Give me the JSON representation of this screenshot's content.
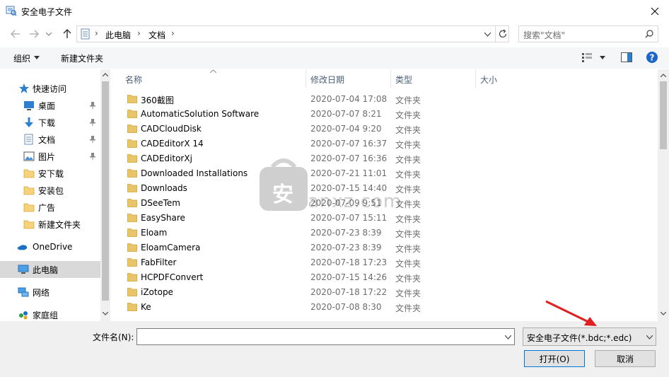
{
  "window": {
    "title": "安全电子文件"
  },
  "address": {
    "breadcrumb": [
      "此电脑",
      "文档"
    ],
    "search_placeholder": "搜索\"文档\""
  },
  "commands": {
    "organize": "组织",
    "new_folder": "新建文件夹"
  },
  "nav": {
    "quick_access": "快速访问",
    "items": [
      {
        "label": "桌面",
        "icon": "desktop-icon",
        "pinned": true
      },
      {
        "label": "下载",
        "icon": "download-icon",
        "pinned": true
      },
      {
        "label": "文档",
        "icon": "document-icon",
        "pinned": true
      },
      {
        "label": "图片",
        "icon": "picture-icon",
        "pinned": true
      },
      {
        "label": "安下载",
        "icon": "folder-icon",
        "pinned": false
      },
      {
        "label": "安装包",
        "icon": "folder-icon",
        "pinned": false
      },
      {
        "label": "广告",
        "icon": "folder-icon",
        "pinned": false
      },
      {
        "label": "新建文件夹",
        "icon": "folder-icon",
        "pinned": false
      }
    ],
    "onedrive": "OneDrive",
    "this_pc": "此电脑",
    "network": "网络",
    "homegroup": "家庭组"
  },
  "columns": {
    "name": "名称",
    "date": "修改日期",
    "type": "类型",
    "size": "大小"
  },
  "files": [
    {
      "name": "360截图",
      "date": "2020-07-04 17:08",
      "type": "文件夹"
    },
    {
      "name": "AutomaticSolution Software",
      "date": "2020-07-07 8:21",
      "type": "文件夹"
    },
    {
      "name": "CADCloudDisk",
      "date": "2020-07-04 9:20",
      "type": "文件夹"
    },
    {
      "name": "CADEditorX 14",
      "date": "2020-07-07 16:37",
      "type": "文件夹"
    },
    {
      "name": "CADEditorXj",
      "date": "2020-07-07 16:36",
      "type": "文件夹"
    },
    {
      "name": "Downloaded Installations",
      "date": "2020-07-21 11:01",
      "type": "文件夹"
    },
    {
      "name": "Downloads",
      "date": "2020-07-15 14:40",
      "type": "文件夹"
    },
    {
      "name": "DSeeTem",
      "date": "2020-07-09 9:51",
      "type": "文件夹"
    },
    {
      "name": "EasyShare",
      "date": "2020-07-07 15:11",
      "type": "文件夹"
    },
    {
      "name": "Eloam",
      "date": "2020-07-23 8:39",
      "type": "文件夹"
    },
    {
      "name": "EloamCamera",
      "date": "2020-07-23 8:39",
      "type": "文件夹"
    },
    {
      "name": "FabFilter",
      "date": "2020-07-18 17:23",
      "type": "文件夹"
    },
    {
      "name": "HCPDFConvert",
      "date": "2020-07-15 14:26",
      "type": "文件夹"
    },
    {
      "name": "iZotope",
      "date": "2020-07-18 17:22",
      "type": "文件夹"
    },
    {
      "name": "Ke",
      "date": "2020-07-08 8:30",
      "type": "文件夹"
    }
  ],
  "bottom": {
    "filename_label": "文件名(N):",
    "filename_value": "",
    "filetype": "安全电子文件(*.bdc;*.edc)",
    "open": "打开(O)",
    "cancel": "取消"
  },
  "watermark": {
    "text": "anxz.com",
    "glyph": "安"
  },
  "colors": {
    "folder": "#e8c46a",
    "accent": "#0078d7",
    "header_text": "#4c607a",
    "arrow": "#e02020"
  }
}
